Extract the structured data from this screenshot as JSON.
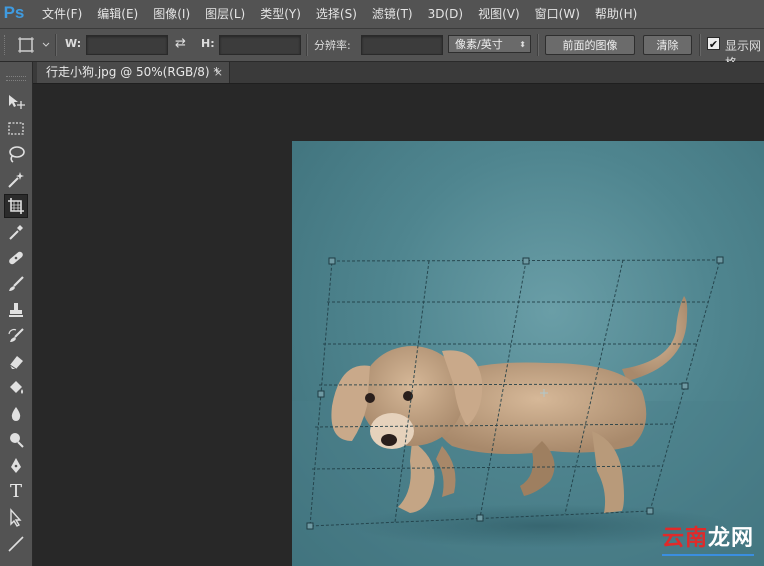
{
  "app": {
    "logo": "Ps"
  },
  "menu": {
    "items": [
      "文件(F)",
      "编辑(E)",
      "图像(I)",
      "图层(L)",
      "类型(Y)",
      "选择(S)",
      "滤镜(T)",
      "3D(D)",
      "视图(V)",
      "窗口(W)",
      "帮助(H)"
    ]
  },
  "options": {
    "w_label": "W:",
    "h_label": "H:",
    "resolution_label": "分辨率:",
    "unit_select": "像素/英寸",
    "front_image_button": "前面的图像",
    "clear_button": "清除",
    "show_grid_label": "显示网格",
    "show_grid_checked": true
  },
  "document": {
    "tab_title": "行走小狗.jpg @ 50%(RGB/8) *",
    "close": "×"
  },
  "toolbar": {
    "tools": [
      "move-tool",
      "rectangular-marquee-tool",
      "lasso-tool",
      "magic-wand-tool",
      "crop-tool",
      "eyedropper-tool",
      "healing-brush-tool",
      "brush-tool",
      "clone-stamp-tool",
      "history-brush-tool",
      "eraser-tool",
      "paint-bucket-tool",
      "blur-tool",
      "dodge-tool",
      "pen-tool",
      "type-tool",
      "path-selection-tool",
      "line-tool"
    ],
    "active": "crop-tool"
  },
  "watermark": {
    "part1": "云南",
    "part2": "龙网"
  },
  "colors": {
    "accent_logo": "#3f9be0",
    "panel": "#535353",
    "canvas_bg": "#282828",
    "image_bg": "#5a8f98"
  }
}
